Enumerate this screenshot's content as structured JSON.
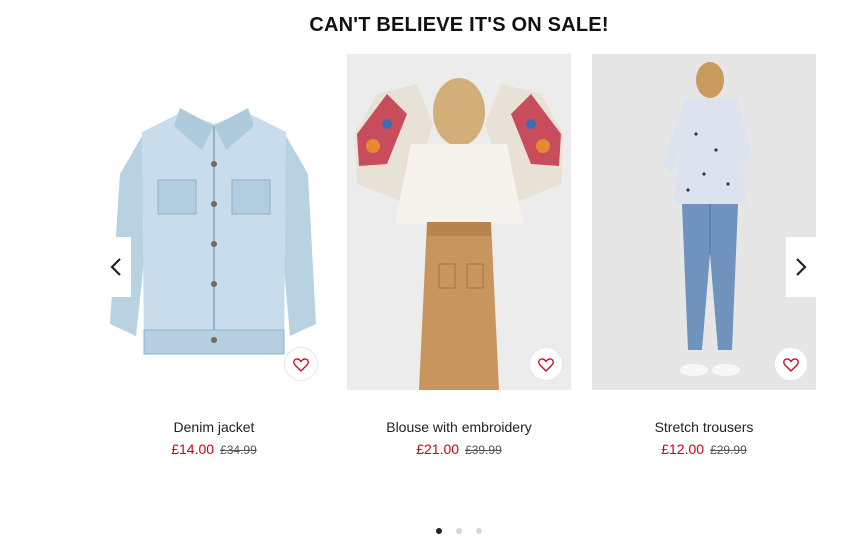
{
  "carousel": {
    "title": "CAN'T BELIEVE IT'S ON SALE!",
    "prev_icon": "chevron-left-icon",
    "next_icon": "chevron-right-icon",
    "favorite_icon": "heart-icon",
    "accent_color": "#d0021b",
    "products": [
      {
        "name": "Denim jacket",
        "sale_price": "£14.00",
        "original_price": "£34.99"
      },
      {
        "name": "Blouse with embroidery",
        "sale_price": "£21.00",
        "original_price": "£39.99"
      },
      {
        "name": "Stretch trousers",
        "sale_price": "£12.00",
        "original_price": "£29.99"
      }
    ],
    "pagination": {
      "pages": 3,
      "current": 1
    }
  }
}
